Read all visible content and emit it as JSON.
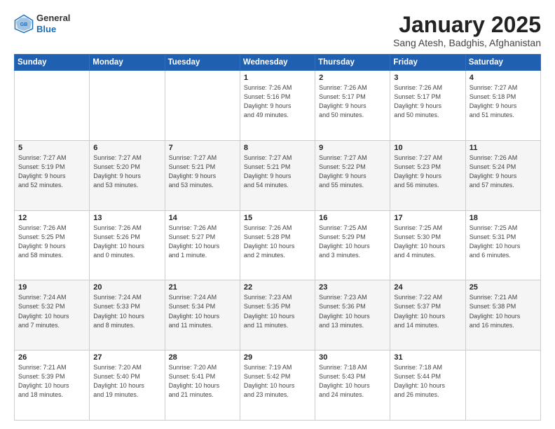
{
  "header": {
    "logo_line1": "General",
    "logo_line2": "Blue",
    "title": "January 2025",
    "subtitle": "Sang Atesh, Badghis, Afghanistan"
  },
  "weekdays": [
    "Sunday",
    "Monday",
    "Tuesday",
    "Wednesday",
    "Thursday",
    "Friday",
    "Saturday"
  ],
  "weeks": [
    [
      {
        "day": "",
        "info": ""
      },
      {
        "day": "",
        "info": ""
      },
      {
        "day": "",
        "info": ""
      },
      {
        "day": "1",
        "info": "Sunrise: 7:26 AM\nSunset: 5:16 PM\nDaylight: 9 hours\nand 49 minutes."
      },
      {
        "day": "2",
        "info": "Sunrise: 7:26 AM\nSunset: 5:17 PM\nDaylight: 9 hours\nand 50 minutes."
      },
      {
        "day": "3",
        "info": "Sunrise: 7:26 AM\nSunset: 5:17 PM\nDaylight: 9 hours\nand 50 minutes."
      },
      {
        "day": "4",
        "info": "Sunrise: 7:27 AM\nSunset: 5:18 PM\nDaylight: 9 hours\nand 51 minutes."
      }
    ],
    [
      {
        "day": "5",
        "info": "Sunrise: 7:27 AM\nSunset: 5:19 PM\nDaylight: 9 hours\nand 52 minutes."
      },
      {
        "day": "6",
        "info": "Sunrise: 7:27 AM\nSunset: 5:20 PM\nDaylight: 9 hours\nand 53 minutes."
      },
      {
        "day": "7",
        "info": "Sunrise: 7:27 AM\nSunset: 5:21 PM\nDaylight: 9 hours\nand 53 minutes."
      },
      {
        "day": "8",
        "info": "Sunrise: 7:27 AM\nSunset: 5:21 PM\nDaylight: 9 hours\nand 54 minutes."
      },
      {
        "day": "9",
        "info": "Sunrise: 7:27 AM\nSunset: 5:22 PM\nDaylight: 9 hours\nand 55 minutes."
      },
      {
        "day": "10",
        "info": "Sunrise: 7:27 AM\nSunset: 5:23 PM\nDaylight: 9 hours\nand 56 minutes."
      },
      {
        "day": "11",
        "info": "Sunrise: 7:26 AM\nSunset: 5:24 PM\nDaylight: 9 hours\nand 57 minutes."
      }
    ],
    [
      {
        "day": "12",
        "info": "Sunrise: 7:26 AM\nSunset: 5:25 PM\nDaylight: 9 hours\nand 58 minutes."
      },
      {
        "day": "13",
        "info": "Sunrise: 7:26 AM\nSunset: 5:26 PM\nDaylight: 10 hours\nand 0 minutes."
      },
      {
        "day": "14",
        "info": "Sunrise: 7:26 AM\nSunset: 5:27 PM\nDaylight: 10 hours\nand 1 minute."
      },
      {
        "day": "15",
        "info": "Sunrise: 7:26 AM\nSunset: 5:28 PM\nDaylight: 10 hours\nand 2 minutes."
      },
      {
        "day": "16",
        "info": "Sunrise: 7:25 AM\nSunset: 5:29 PM\nDaylight: 10 hours\nand 3 minutes."
      },
      {
        "day": "17",
        "info": "Sunrise: 7:25 AM\nSunset: 5:30 PM\nDaylight: 10 hours\nand 4 minutes."
      },
      {
        "day": "18",
        "info": "Sunrise: 7:25 AM\nSunset: 5:31 PM\nDaylight: 10 hours\nand 6 minutes."
      }
    ],
    [
      {
        "day": "19",
        "info": "Sunrise: 7:24 AM\nSunset: 5:32 PM\nDaylight: 10 hours\nand 7 minutes."
      },
      {
        "day": "20",
        "info": "Sunrise: 7:24 AM\nSunset: 5:33 PM\nDaylight: 10 hours\nand 8 minutes."
      },
      {
        "day": "21",
        "info": "Sunrise: 7:24 AM\nSunset: 5:34 PM\nDaylight: 10 hours\nand 11 minutes."
      },
      {
        "day": "22",
        "info": "Sunrise: 7:23 AM\nSunset: 5:35 PM\nDaylight: 10 hours\nand 11 minutes."
      },
      {
        "day": "23",
        "info": "Sunrise: 7:23 AM\nSunset: 5:36 PM\nDaylight: 10 hours\nand 13 minutes."
      },
      {
        "day": "24",
        "info": "Sunrise: 7:22 AM\nSunset: 5:37 PM\nDaylight: 10 hours\nand 14 minutes."
      },
      {
        "day": "25",
        "info": "Sunrise: 7:21 AM\nSunset: 5:38 PM\nDaylight: 10 hours\nand 16 minutes."
      }
    ],
    [
      {
        "day": "26",
        "info": "Sunrise: 7:21 AM\nSunset: 5:39 PM\nDaylight: 10 hours\nand 18 minutes."
      },
      {
        "day": "27",
        "info": "Sunrise: 7:20 AM\nSunset: 5:40 PM\nDaylight: 10 hours\nand 19 minutes."
      },
      {
        "day": "28",
        "info": "Sunrise: 7:20 AM\nSunset: 5:41 PM\nDaylight: 10 hours\nand 21 minutes."
      },
      {
        "day": "29",
        "info": "Sunrise: 7:19 AM\nSunset: 5:42 PM\nDaylight: 10 hours\nand 23 minutes."
      },
      {
        "day": "30",
        "info": "Sunrise: 7:18 AM\nSunset: 5:43 PM\nDaylight: 10 hours\nand 24 minutes."
      },
      {
        "day": "31",
        "info": "Sunrise: 7:18 AM\nSunset: 5:44 PM\nDaylight: 10 hours\nand 26 minutes."
      },
      {
        "day": "",
        "info": ""
      }
    ]
  ]
}
